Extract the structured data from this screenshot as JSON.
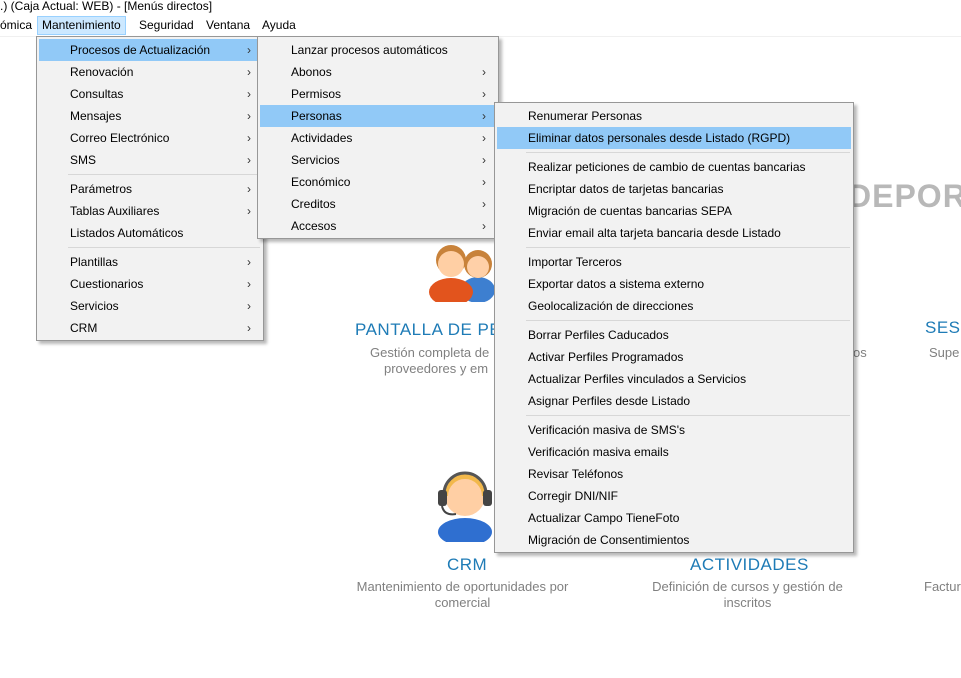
{
  "window": {
    "title": ".)  (Caja Actual: WEB) - [Menús directos]"
  },
  "menubar": {
    "items": [
      "ómica",
      "Mantenimiento",
      "Seguridad",
      "Ventana",
      "Ayuda"
    ]
  },
  "background": {
    "logo_partial": "DEPORW",
    "tiles": {
      "personas": {
        "title": "PANTALLA DE PE",
        "desc_line1": "Gestión completa de",
        "desc_line2": "proveedores y em"
      },
      "sesiones": {
        "title": "SES",
        "desc": "Supe"
      },
      "right_fragment": "os",
      "crm": {
        "title": "CRM",
        "desc_line1": "Mantenimiento de oportunidades por",
        "desc_line2": "comercial"
      },
      "actividades": {
        "title": "ACTIVIDADES",
        "desc_line1": "Definición de cursos y gestión de",
        "desc_line2": "inscritos"
      },
      "factur": {
        "desc": "Factur"
      }
    }
  },
  "menu_mantenimiento": {
    "group1": [
      {
        "label": "Procesos de Actualización",
        "submenu": true,
        "highlighted": true
      },
      {
        "label": "Renovación",
        "submenu": true
      },
      {
        "label": "Consultas",
        "submenu": true
      },
      {
        "label": "Mensajes",
        "submenu": true
      },
      {
        "label": "Correo Electrónico",
        "submenu": true
      },
      {
        "label": "SMS",
        "submenu": true
      }
    ],
    "group2": [
      {
        "label": "Parámetros",
        "submenu": true
      },
      {
        "label": "Tablas Auxiliares",
        "submenu": true
      },
      {
        "label": "Listados Automáticos",
        "submenu": false
      }
    ],
    "group3": [
      {
        "label": "Plantillas",
        "submenu": true
      },
      {
        "label": "Cuestionarios",
        "submenu": true
      },
      {
        "label": "Servicios",
        "submenu": true
      },
      {
        "label": "CRM",
        "submenu": true
      }
    ]
  },
  "menu_procesos": {
    "items": [
      {
        "label": "Lanzar procesos automáticos",
        "submenu": false
      },
      {
        "label": "Abonos",
        "submenu": true
      },
      {
        "label": "Permisos",
        "submenu": true
      },
      {
        "label": "Personas",
        "submenu": true,
        "highlighted": true
      },
      {
        "label": "Actividades",
        "submenu": true
      },
      {
        "label": "Servicios",
        "submenu": true
      },
      {
        "label": "Económico",
        "submenu": true
      },
      {
        "label": "Creditos",
        "submenu": true
      },
      {
        "label": "Accesos",
        "submenu": true
      }
    ]
  },
  "menu_personas": {
    "group1": [
      {
        "label": "Renumerar Personas"
      },
      {
        "label": "Eliminar datos personales desde Listado (RGPD)",
        "highlighted": true
      }
    ],
    "group2": [
      {
        "label": "Realizar peticiones de cambio de cuentas bancarias"
      },
      {
        "label": "Encriptar datos de tarjetas bancarias"
      },
      {
        "label": "Migración de cuentas bancarias SEPA"
      },
      {
        "label": "Enviar email alta tarjeta bancaria desde Listado"
      }
    ],
    "group3": [
      {
        "label": "Importar Terceros"
      },
      {
        "label": "Exportar datos a sistema externo"
      },
      {
        "label": "Geolocalización de direcciones"
      }
    ],
    "group4": [
      {
        "label": "Borrar Perfiles Caducados"
      },
      {
        "label": "Activar Perfiles Programados"
      },
      {
        "label": "Actualizar Perfiles vinculados a Servicios"
      },
      {
        "label": "Asignar Perfiles desde Listado"
      }
    ],
    "group5": [
      {
        "label": "Verificación masiva de SMS's"
      },
      {
        "label": "Verificación masiva emails"
      },
      {
        "label": "Revisar Teléfonos"
      },
      {
        "label": "Corregir DNI/NIF"
      },
      {
        "label": "Actualizar Campo TieneFoto"
      },
      {
        "label": "Migración de Consentimientos"
      }
    ]
  },
  "colors": {
    "highlight": "#91c9f7",
    "menubar_active": "#cce8ff",
    "tile_title": "#1e7bb6"
  },
  "icons": {
    "submenu_arrow": "›",
    "people": "people-icon",
    "support": "headset-user-icon"
  }
}
